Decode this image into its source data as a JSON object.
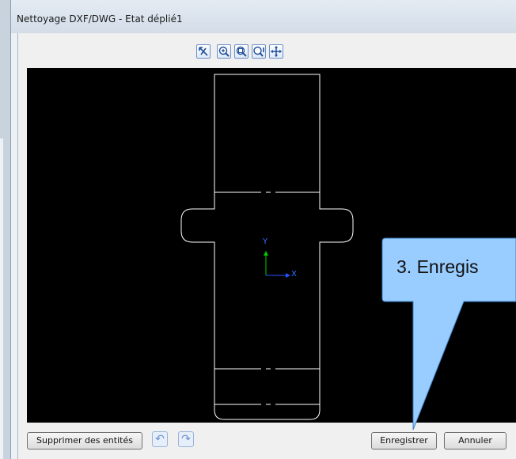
{
  "window": {
    "title": "Nettoyage DXF/DWG - Etat déplié1"
  },
  "toolbar": {
    "icons": [
      "zoom-fit-icon",
      "zoom-in-icon",
      "zoom-window-icon",
      "zoom-out-icon",
      "pan-icon"
    ]
  },
  "canvas": {
    "background": "#000000",
    "axis_y": "Y",
    "axis_x": "X",
    "axis_y_color": "#00cc00",
    "axis_x_color": "#2255ff"
  },
  "footer": {
    "delete_entities": "Supprimer des entités",
    "undo_icon": "undo-icon",
    "redo_icon": "redo-icon",
    "save": "Enregistrer",
    "cancel": "Annuler"
  },
  "callout": {
    "text": "3. Enregis",
    "color": "#99ccff"
  }
}
